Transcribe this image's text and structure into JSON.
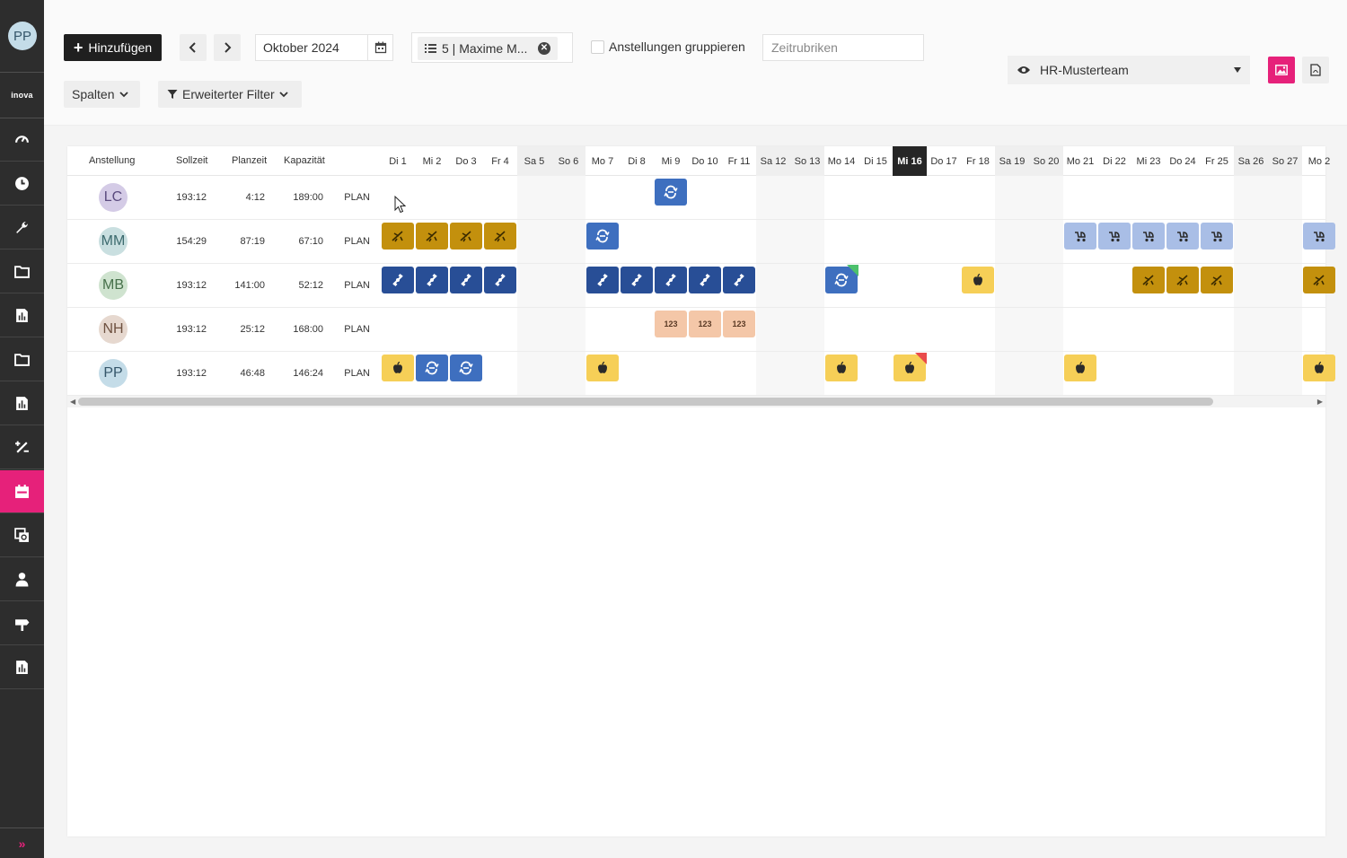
{
  "app": {
    "user_initials": "PP",
    "logo_text": "inova",
    "accent_color": "#e6217a",
    "nav_icons": [
      "dashboard-icon",
      "clock-icon",
      "wrench-icon",
      "folder-icon",
      "report-icon",
      "folder-icon",
      "report-icon",
      "percent-icon",
      "calendar-icon",
      "copy-icon",
      "person-icon",
      "signpost-icon",
      "report-icon"
    ],
    "active_nav": 8,
    "expand_glyph": "»"
  },
  "toolbar": {
    "add_label": "Hinzufügen",
    "month": "Oktober 2024",
    "filter_chip": "5 | Maxime M...",
    "group_label": "Anstellungen gruppieren",
    "search_placeholder": "Zeitrubriken",
    "view_label": "HR-Musterteam",
    "columns_label": "Spalten",
    "extended_filter_label": "Erweiterter Filter"
  },
  "grid": {
    "headers": {
      "employment": "Anstellung",
      "target": "Sollzeit",
      "planned": "Planzeit",
      "capacity": "Kapazität"
    },
    "days": [
      {
        "label": "Di 1",
        "weekend": false
      },
      {
        "label": "Mi 2",
        "weekend": false
      },
      {
        "label": "Do 3",
        "weekend": false
      },
      {
        "label": "Fr 4",
        "weekend": false
      },
      {
        "label": "Sa 5",
        "weekend": true
      },
      {
        "label": "So 6",
        "weekend": true
      },
      {
        "label": "Mo 7",
        "weekend": false
      },
      {
        "label": "Di 8",
        "weekend": false
      },
      {
        "label": "Mi 9",
        "weekend": false
      },
      {
        "label": "Do 10",
        "weekend": false
      },
      {
        "label": "Fr 11",
        "weekend": false
      },
      {
        "label": "Sa 12",
        "weekend": true
      },
      {
        "label": "So 13",
        "weekend": true
      },
      {
        "label": "Mo 14",
        "weekend": false
      },
      {
        "label": "Di 15",
        "weekend": false
      },
      {
        "label": "Mi 16",
        "weekend": false,
        "today": true
      },
      {
        "label": "Do 17",
        "weekend": false
      },
      {
        "label": "Fr 18",
        "weekend": false
      },
      {
        "label": "Sa 19",
        "weekend": true
      },
      {
        "label": "So 20",
        "weekend": true
      },
      {
        "label": "Mo 21",
        "weekend": false
      },
      {
        "label": "Di 22",
        "weekend": false
      },
      {
        "label": "Mi 23",
        "weekend": false
      },
      {
        "label": "Do 24",
        "weekend": false
      },
      {
        "label": "Fr 25",
        "weekend": false
      },
      {
        "label": "Sa 26",
        "weekend": true
      },
      {
        "label": "So 27",
        "weekend": true
      },
      {
        "label": "Mo 2",
        "weekend": false
      }
    ],
    "rows": [
      {
        "initials": "LC",
        "avatar_bg": "#d4cbe6",
        "avatar_fg": "#5a4a7e",
        "sollzeit": "193:12",
        "planzeit": "4:12",
        "kapazitaet": "189:00",
        "plan": "PLAN",
        "tiles": [
          {
            "day": 8,
            "kind": "sync"
          }
        ]
      },
      {
        "initials": "MM",
        "avatar_bg": "#c9dfe0",
        "avatar_fg": "#3c6a6e",
        "sollzeit": "154:29",
        "planzeit": "87:19",
        "kapazitaet": "67:10",
        "plan": "PLAN",
        "tiles": [
          {
            "day": 0,
            "kind": "vacation"
          },
          {
            "day": 1,
            "kind": "vacation"
          },
          {
            "day": 2,
            "kind": "vacation"
          },
          {
            "day": 3,
            "kind": "vacation"
          },
          {
            "day": 6,
            "kind": "sync"
          },
          {
            "day": 20,
            "kind": "parental"
          },
          {
            "day": 21,
            "kind": "parental"
          },
          {
            "day": 22,
            "kind": "parental"
          },
          {
            "day": 23,
            "kind": "parental"
          },
          {
            "day": 24,
            "kind": "parental"
          },
          {
            "day": 27,
            "kind": "parental"
          }
        ]
      },
      {
        "initials": "MB",
        "avatar_bg": "#cfe3cf",
        "avatar_fg": "#46704a",
        "sollzeit": "193:12",
        "planzeit": "141:00",
        "kapazitaet": "52:12",
        "plan": "PLAN",
        "tiles": [
          {
            "day": 0,
            "kind": "satellite"
          },
          {
            "day": 1,
            "kind": "satellite"
          },
          {
            "day": 2,
            "kind": "satellite"
          },
          {
            "day": 3,
            "kind": "satellite"
          },
          {
            "day": 6,
            "kind": "satellite"
          },
          {
            "day": 7,
            "kind": "satellite"
          },
          {
            "day": 8,
            "kind": "satellite"
          },
          {
            "day": 9,
            "kind": "satellite"
          },
          {
            "day": 10,
            "kind": "satellite"
          },
          {
            "day": 13,
            "kind": "sync",
            "badge": "ok"
          },
          {
            "day": 17,
            "kind": "apple"
          },
          {
            "day": 22,
            "kind": "vacation"
          },
          {
            "day": 23,
            "kind": "vacation"
          },
          {
            "day": 24,
            "kind": "vacation"
          },
          {
            "day": 27,
            "kind": "vacation"
          }
        ]
      },
      {
        "initials": "NH",
        "avatar_bg": "#e6d8cf",
        "avatar_fg": "#6e5140",
        "sollzeit": "193:12",
        "planzeit": "25:12",
        "kapazitaet": "168:00",
        "plan": "PLAN",
        "tiles": [
          {
            "day": 8,
            "kind": "numbers",
            "text": "123"
          },
          {
            "day": 9,
            "kind": "numbers",
            "text": "123"
          },
          {
            "day": 10,
            "kind": "numbers",
            "text": "123"
          }
        ]
      },
      {
        "initials": "PP",
        "avatar_bg": "#c4dce8",
        "avatar_fg": "#35566a",
        "sollzeit": "193:12",
        "planzeit": "46:48",
        "kapazitaet": "146:24",
        "plan": "PLAN",
        "tiles": [
          {
            "day": 0,
            "kind": "apple"
          },
          {
            "day": 1,
            "kind": "sync"
          },
          {
            "day": 2,
            "kind": "sync"
          },
          {
            "day": 6,
            "kind": "apple"
          },
          {
            "day": 13,
            "kind": "apple"
          },
          {
            "day": 15,
            "kind": "apple",
            "badge": "x"
          },
          {
            "day": 20,
            "kind": "apple"
          },
          {
            "day": 27,
            "kind": "apple"
          }
        ]
      }
    ],
    "tile_colors": {
      "vacation": "#c3900d",
      "sync": "#3e6fbf",
      "satellite": "#284e96",
      "parental": "#a9bee6",
      "apple": "#f6cf57",
      "numbers": "#f4c7a8"
    }
  }
}
